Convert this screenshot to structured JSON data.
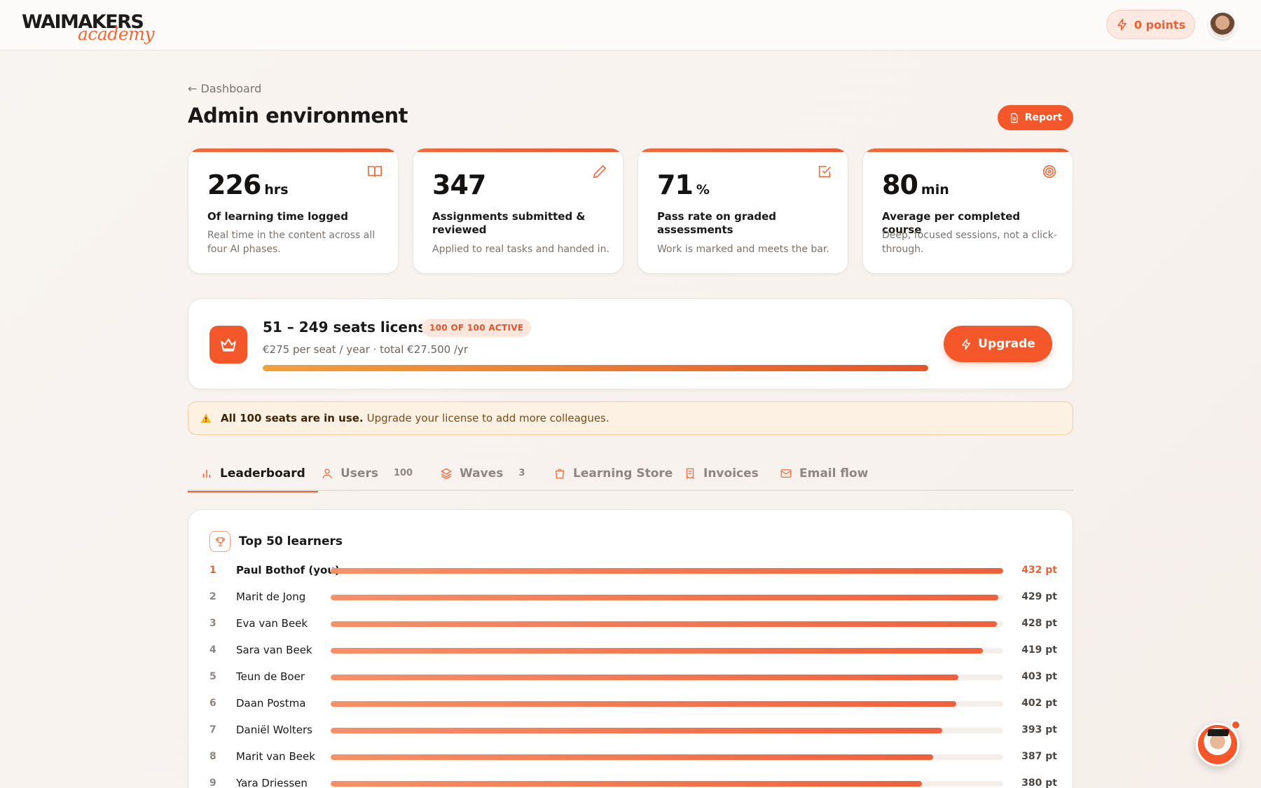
{
  "brand": {
    "logo_top": "WAIMAKERS",
    "logo_bottom": "academy",
    "accent": "#f4572a"
  },
  "header": {
    "points_label": "0 points"
  },
  "page": {
    "back_label": "← Dashboard",
    "title": "Admin environment",
    "report_label": "Report"
  },
  "stats": [
    {
      "value": "226",
      "unit": "hrs",
      "label": "Of learning time logged",
      "desc": "Real time in the content across all four AI phases.",
      "icon": "book-icon"
    },
    {
      "value": "347",
      "unit": "",
      "label": "Assignments submitted & reviewed",
      "desc": "Applied to real tasks and handed in.",
      "icon": "pencil-icon"
    },
    {
      "value": "71",
      "unit": "%",
      "label": "Pass rate on graded assessments",
      "desc": "Work is marked and meets the bar.",
      "icon": "check-square-icon"
    },
    {
      "value": "80",
      "unit": "min",
      "label": "Average per completed course",
      "desc": "Deep, focused sessions, not a click-through.",
      "icon": "target-icon"
    }
  ],
  "license": {
    "title": "51 – 249 seats license",
    "badge": "100 OF 100 ACTIVE",
    "subtitle": "€275 per seat / year · total €27.500 /yr",
    "progress": 1.0,
    "upgrade_label": "Upgrade"
  },
  "alert": {
    "bold": "All 100 seats are in use.",
    "text": "Upgrade your license to add more colleagues."
  },
  "tabs": [
    {
      "label": "Leaderboard",
      "count": "",
      "icon": "bar-chart-icon"
    },
    {
      "label": "Users",
      "count": "100",
      "icon": "user-icon"
    },
    {
      "label": "Waves",
      "count": "3",
      "icon": "layers-icon"
    },
    {
      "label": "Learning Store",
      "count": "",
      "icon": "shopping-bag-icon"
    },
    {
      "label": "Invoices",
      "count": "",
      "icon": "receipt-icon"
    },
    {
      "label": "Email flow",
      "count": "",
      "icon": "mail-icon"
    }
  ],
  "leaderboard": {
    "title": "Top 50 learners",
    "max_points": 432,
    "rows": [
      {
        "rank": "1",
        "name": "Paul Bothof (you)",
        "points": 432,
        "points_label": "432 pt"
      },
      {
        "rank": "2",
        "name": "Marit de Jong",
        "points": 429,
        "points_label": "429 pt"
      },
      {
        "rank": "3",
        "name": "Eva van Beek",
        "points": 428,
        "points_label": "428 pt"
      },
      {
        "rank": "4",
        "name": "Sara van Beek",
        "points": 419,
        "points_label": "419 pt"
      },
      {
        "rank": "5",
        "name": "Teun de Boer",
        "points": 403,
        "points_label": "403 pt"
      },
      {
        "rank": "6",
        "name": "Daan Postma",
        "points": 402,
        "points_label": "402 pt"
      },
      {
        "rank": "7",
        "name": "Daniël Wolters",
        "points": 393,
        "points_label": "393 pt"
      },
      {
        "rank": "8",
        "name": "Marit van Beek",
        "points": 387,
        "points_label": "387 pt"
      },
      {
        "rank": "9",
        "name": "Yara Driessen",
        "points": 380,
        "points_label": "380 pt"
      }
    ]
  }
}
